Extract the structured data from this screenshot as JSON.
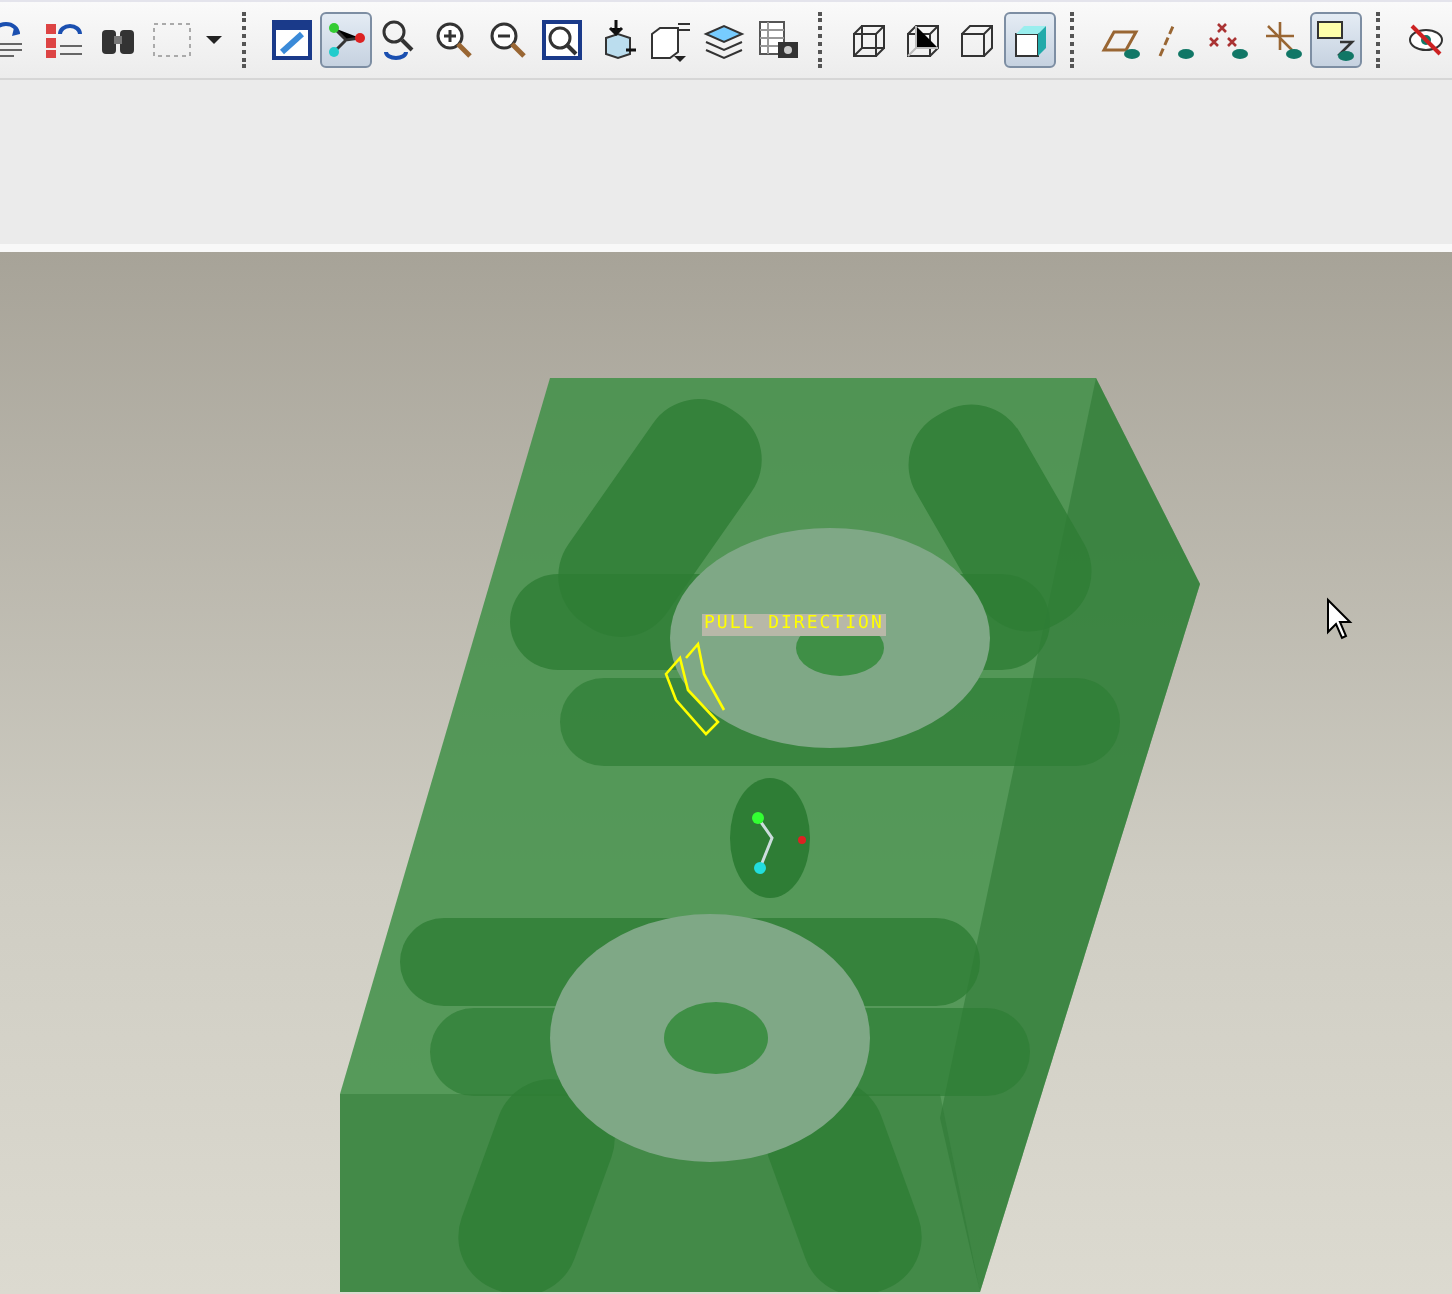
{
  "toolbar": {
    "groups": [
      {
        "buttons": [
          {
            "selected": false
          },
          {
            "selected": false
          },
          {
            "selected": false
          },
          {
            "selected": false
          },
          {
            "selected": false
          }
        ]
      },
      {
        "buttons": [
          {
            "selected": false
          },
          {
            "selected": true
          },
          {
            "selected": false
          },
          {
            "selected": false
          },
          {
            "selected": false
          },
          {
            "selected": false
          },
          {
            "selected": false
          },
          {
            "selected": false
          },
          {
            "selected": false
          },
          {
            "selected": false
          }
        ]
      },
      {
        "buttons": [
          {
            "selected": false
          },
          {
            "selected": false
          },
          {
            "selected": false
          },
          {
            "selected": true
          }
        ]
      },
      {
        "buttons": [
          {
            "selected": false
          },
          {
            "selected": false
          },
          {
            "selected": false
          },
          {
            "selected": false
          },
          {
            "selected": true
          }
        ]
      },
      {
        "buttons": [
          {
            "selected": false
          }
        ]
      }
    ]
  },
  "viewport": {
    "pull_direction_label": "PULL DIRECTION"
  }
}
